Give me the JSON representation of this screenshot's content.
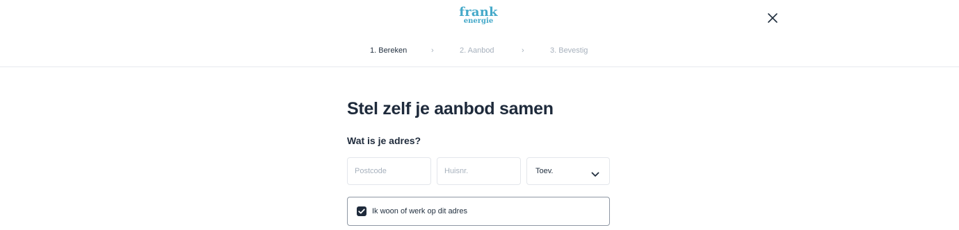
{
  "brand": {
    "logo_top": "frank",
    "logo_bottom": "energie",
    "color": "#45a9c9"
  },
  "header": {
    "close_icon": "close-icon"
  },
  "stepper": {
    "steps": [
      {
        "label": "1. Bereken",
        "active": true
      },
      {
        "label": "2. Aanbod",
        "active": false
      },
      {
        "label": "3. Bevestig",
        "active": false
      }
    ],
    "separator": "›"
  },
  "form": {
    "title": "Stel zelf je aanbod samen",
    "address_question": "Wat is je adres?",
    "postcode": {
      "placeholder": "Postcode",
      "value": ""
    },
    "house_number": {
      "placeholder": "Huisnr.",
      "value": ""
    },
    "addition": {
      "selected": "Toev."
    },
    "live_or_work": {
      "label": "Ik woon of werk op dit adres",
      "checked": true
    }
  },
  "colors": {
    "text_dark": "#1e2a3b",
    "muted": "#a7b1bd",
    "border": "#e3e6eb"
  }
}
